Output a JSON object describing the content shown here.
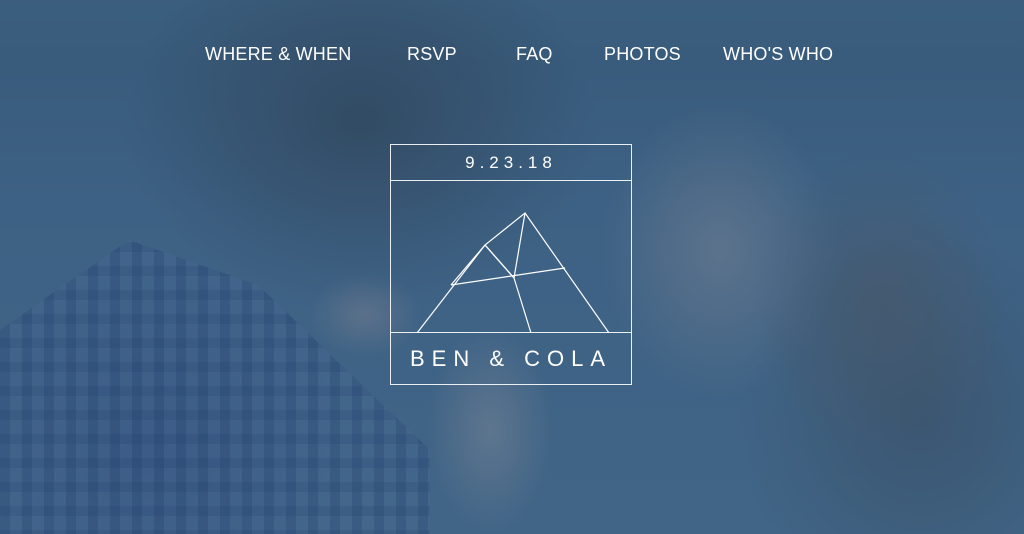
{
  "nav": {
    "items": [
      {
        "label": "WHERE & WHEN"
      },
      {
        "label": "RSVP"
      },
      {
        "label": "FAQ"
      },
      {
        "label": "PHOTOS"
      },
      {
        "label": "WHO'S WHO"
      }
    ]
  },
  "logo": {
    "date": "9.23.18",
    "names": "BEN & COLA",
    "mark_icon": "mountain-peaks-icon"
  },
  "colors": {
    "overlay": "#2f5477",
    "text": "#ffffff"
  }
}
